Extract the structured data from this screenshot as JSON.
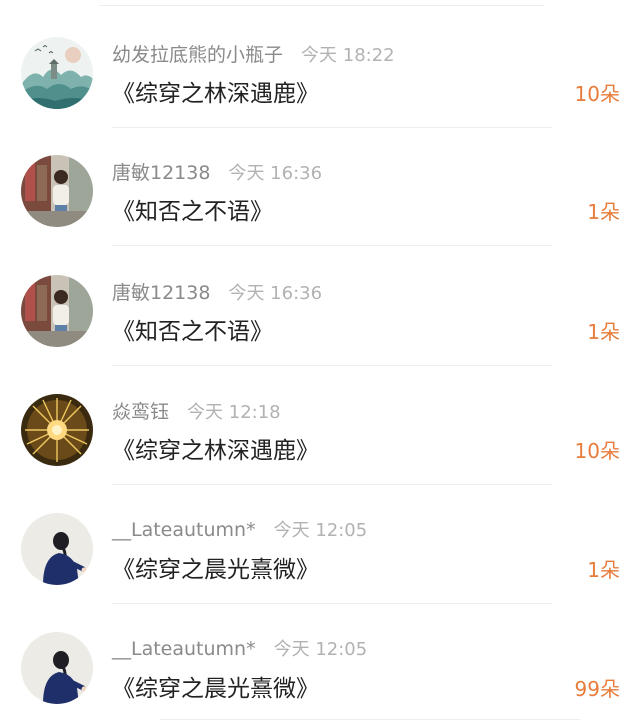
{
  "rows": [
    {
      "username": "幼发拉底熊的小瓶子",
      "time": "今天 18:22",
      "title": "《综穿之林深遇鹿》",
      "count": "10朵",
      "avatar": "landscape-avatar"
    },
    {
      "username": "唐敏12138",
      "time": "今天 16:36",
      "title": "《知否之不语》",
      "count": "1朵",
      "avatar": "person-photo-avatar"
    },
    {
      "username": "唐敏12138",
      "time": "今天 16:36",
      "title": "《知否之不语》",
      "count": "1朵",
      "avatar": "person-photo-avatar"
    },
    {
      "username": "焱鸾钰",
      "time": "今天 12:18",
      "title": "《综穿之林深遇鹿》",
      "count": "10朵",
      "avatar": "golden-burst-avatar"
    },
    {
      "username": "__Lateautumn*",
      "time": "今天 12:05",
      "title": "《综穿之晨光熹微》",
      "count": "1朵",
      "avatar": "girl-illustration-avatar"
    },
    {
      "username": "__Lateautumn*",
      "time": "今天 12:05",
      "title": "《综穿之晨光熹微》",
      "count": "99朵",
      "avatar": "girl-illustration-avatar"
    }
  ],
  "colors": {
    "count": "#e87c3a",
    "username": "#8a8a8a",
    "time": "#b2b2b2",
    "title": "#222222"
  }
}
